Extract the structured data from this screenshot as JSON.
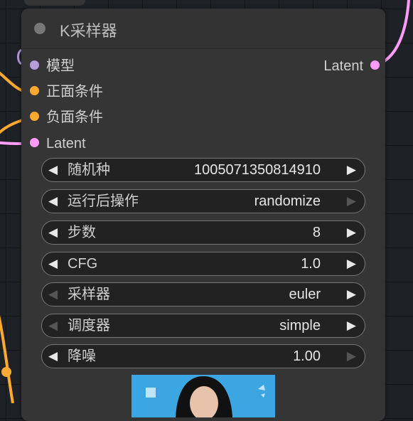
{
  "node": {
    "title": "K采样器",
    "inputs": [
      {
        "label": "模型",
        "color": "#b39ddb"
      },
      {
        "label": "正面条件",
        "color": "#ffa931"
      },
      {
        "label": "负面条件",
        "color": "#ffa931"
      },
      {
        "label": "Latent",
        "color": "#ff9cf9"
      }
    ],
    "output": {
      "label": "Latent",
      "color": "#ff9cf9"
    },
    "widgets": [
      {
        "label": "随机种",
        "value": "1005071350814910"
      },
      {
        "label": "运行后操作",
        "value": "randomize"
      },
      {
        "label": "步数",
        "value": "8"
      },
      {
        "label": "CFG",
        "value": "1.0"
      },
      {
        "label": "采样器",
        "value": "euler"
      },
      {
        "label": "调度器",
        "value": "simple"
      },
      {
        "label": "降噪",
        "value": "1.00"
      }
    ]
  },
  "wire_colors": {
    "conditioning": "#ffa931",
    "latent": "#ff9cf9",
    "model": "#b39ddb"
  }
}
